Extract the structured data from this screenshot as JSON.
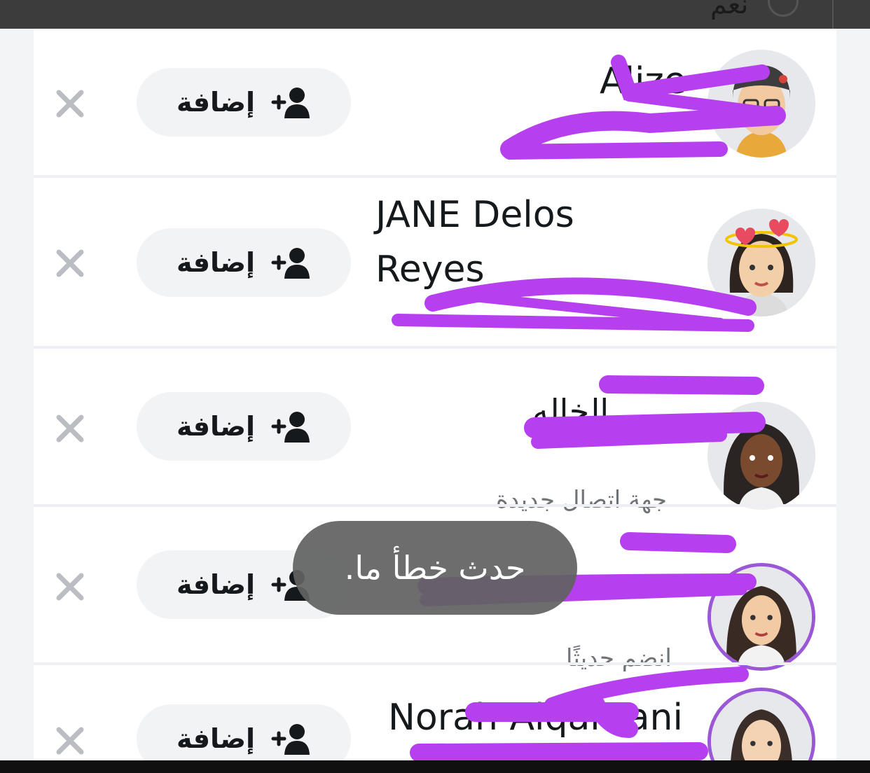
{
  "top": {
    "yes_label": "نعم"
  },
  "rows": [
    {
      "name": "Alize",
      "subtitle": "",
      "add_label": "إضافة"
    },
    {
      "name": "JANE Delos Reyes",
      "name_line1": "JANE Delos",
      "name_line2": "Reyes",
      "subtitle": "",
      "add_label": "إضافة"
    },
    {
      "name": "الخاله",
      "subtitle": "جهة اتصال جديدة",
      "add_label": "إضافة"
    },
    {
      "name": "",
      "subtitle": "انضم حديثًا",
      "add_label": "إضافة"
    },
    {
      "name": "Norah Alqahtani",
      "subtitle": "",
      "add_label": "إضافة"
    }
  ],
  "toast": {
    "text": "حدث خطأ ما."
  },
  "icons": {
    "dismiss": "close-icon",
    "add_friend": "add-friend-icon",
    "avatar": "bitmoji-avatar"
  },
  "colors": {
    "accent": "#9a57d6",
    "redaction": "#b640f0",
    "button_bg": "#f2f3f5",
    "toast_bg": "#626262"
  }
}
